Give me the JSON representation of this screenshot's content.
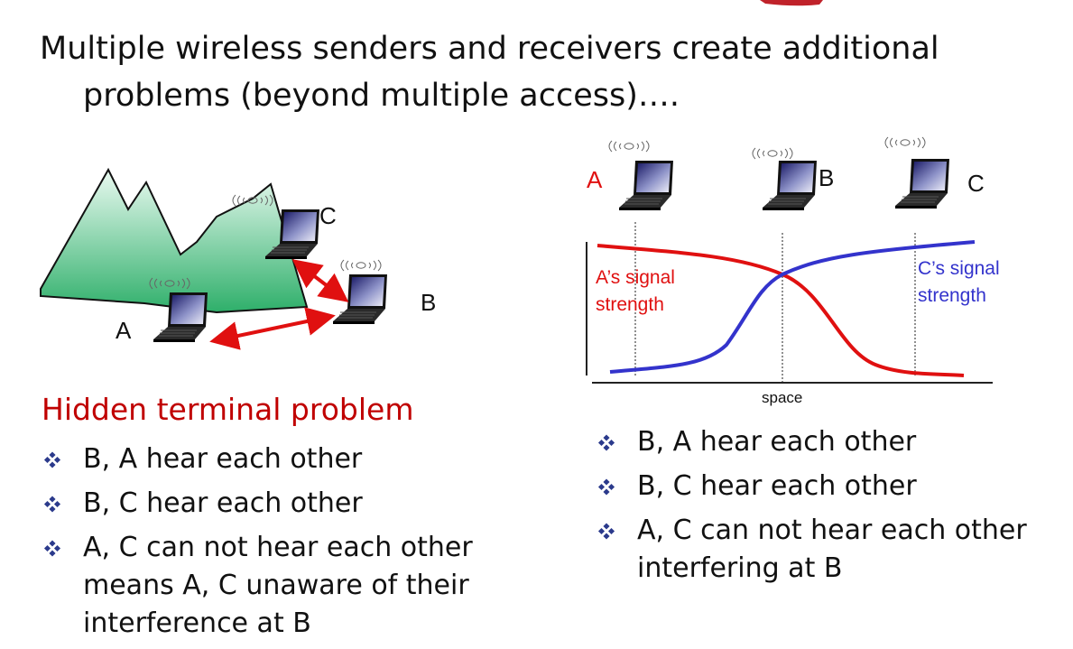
{
  "title": {
    "line1": "Multiple wireless senders and receivers create additional",
    "line2": "problems (beyond multiple access)…."
  },
  "left_diagram": {
    "node_a": "A",
    "node_b": "B",
    "node_c": "C"
  },
  "right_diagram": {
    "node_a": "A",
    "node_b": "B",
    "node_c": "C",
    "a_signal_line1": "A’s signal",
    "a_signal_line2": "strength",
    "c_signal_line1": "C’s signal",
    "c_signal_line2": "strength",
    "xlabel": "space"
  },
  "hidden_terminal": {
    "heading": "Hidden terminal problem",
    "bullets": [
      {
        "line1": "B,  A hear each other"
      },
      {
        "line1": "B, C hear each other"
      },
      {
        "line1": "A, C can not hear each other",
        "line2": "means A, C unaware of their",
        "line3": "interference at B"
      }
    ]
  },
  "signal_attenuation": {
    "bullets": [
      {
        "line1": "B, A hear each other"
      },
      {
        "line1": "B, C hear each other"
      },
      {
        "line1": "A, C can not hear each other",
        "line2": "interfering at B"
      }
    ]
  },
  "colors": {
    "accent_red": "#e01010",
    "accent_blue": "#3333cc",
    "heading_red": "#c00000",
    "mountain_green": "#52c08a"
  }
}
